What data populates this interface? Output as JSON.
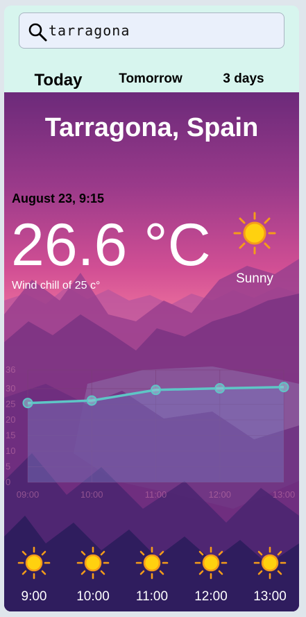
{
  "search": {
    "value": "tarragona",
    "icon": "search-icon"
  },
  "tabs": [
    {
      "label": "Today",
      "active": true
    },
    {
      "label": "Tomorrow",
      "active": false
    },
    {
      "label": "3 days",
      "active": false
    }
  ],
  "location": "Tarragona, Spain",
  "current": {
    "datetime": "August 23, 9:15",
    "temperature": "26.6 °C",
    "wind_chill": "Wind chill of 25 c°",
    "condition": "Sunny",
    "icon": "sun-icon"
  },
  "chart_data": {
    "type": "area",
    "x": [
      "09:00",
      "10:00",
      "11:00",
      "12:00",
      "13:00"
    ],
    "values": [
      25.4,
      26.2,
      29.6,
      30.1,
      30.5
    ],
    "ylim": [
      0,
      36
    ],
    "yticks": [
      "0",
      "5",
      "10",
      "15",
      "20",
      "25",
      "30",
      "36"
    ],
    "xlabel": "",
    "ylabel": "",
    "grid": true,
    "line_color": "#5ec6c6"
  },
  "hourly": [
    {
      "time": "9:00",
      "icon": "sun-icon"
    },
    {
      "time": "10:00",
      "icon": "sun-icon"
    },
    {
      "time": "11:00",
      "icon": "sun-icon"
    },
    {
      "time": "12:00",
      "icon": "sun-icon"
    },
    {
      "time": "13:00",
      "icon": "sun-icon"
    }
  ]
}
